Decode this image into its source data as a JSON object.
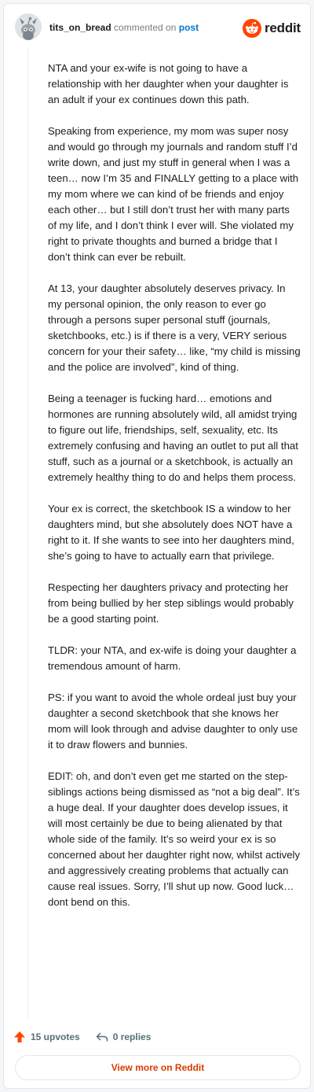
{
  "header": {
    "username": "tits_on_bread",
    "action": "commented on",
    "post_link": "post",
    "brand": "reddit"
  },
  "comment": {
    "paragraphs": [
      "NTA and your ex-wife is not going to have a relationship with her daughter when your daughter is an adult if your ex continues down this path.",
      "Speaking from experience, my mom was super nosy and would go through my journals and random stuff I’d write down, and just my stuff in general when I was a teen… now I’m 35 and FINALLY getting to a place with my mom where we can kind of be friends and enjoy each other… but I still don’t trust her with many parts of my life, and I don’t think I ever will. She violated my right to private thoughts and burned a bridge that I don’t think can ever be rebuilt.",
      "At 13, your daughter absolutely deserves privacy. In my personal opinion, the only reason to ever go through a persons super personal stuff (journals, sketchbooks, etc.) is if there is a very, VERY serious concern for your their safety… like, “my child is missing and the police are involved”, kind of thing.",
      "Being a teenager is fucking hard… emotions and hormones are running absolutely wild, all amidst trying to figure out life, friendships, self, sexuality, etc. Its extremely confusing and having an outlet to put all that stuff, such as a journal or a sketchbook, is actually an extremely healthy thing to do and helps them process.",
      "Your ex is correct, the sketchbook IS a window to her daughters mind, but she absolutely does NOT have a right to it. If she wants to see into her daughters mind, she’s going to have to actually earn that privilege.",
      "Respecting her daughters privacy and protecting her from being bullied by her step siblings would probably be a good starting point.",
      "TLDR: your NTA, and ex-wife is doing your daughter a tremendous amount of harm.",
      "PS: if you want to avoid the whole ordeal just buy your daughter a second sketchbook that she knows her mom will look through and advise daughter to only use it to draw flowers and bunnies.",
      "EDIT: oh, and don’t even get me started on the step-siblings actions being dismissed as “not a big deal”. It’s a huge deal. If your daughter does develop issues, it will most certainly be due to being alienated by that whole side of the family. It’s so weird your ex is so concerned about her daughter right now, whilst actively and aggressively creating problems that actually can cause real issues. Sorry, I’ll shut up now. Good luck… dont bend on this."
    ]
  },
  "footer": {
    "upvotes": "15 upvotes",
    "replies": "0 replies",
    "view_more": "View more on Reddit"
  },
  "colors": {
    "accent": "#ff4500",
    "link": "#0079d3",
    "view_more": "#d93a00"
  },
  "icons": {
    "avatar": "snoo-avatar-icon",
    "brand": "reddit-logo-icon",
    "upvote": "upvote-arrow-icon",
    "reply": "reply-arrow-icon"
  }
}
